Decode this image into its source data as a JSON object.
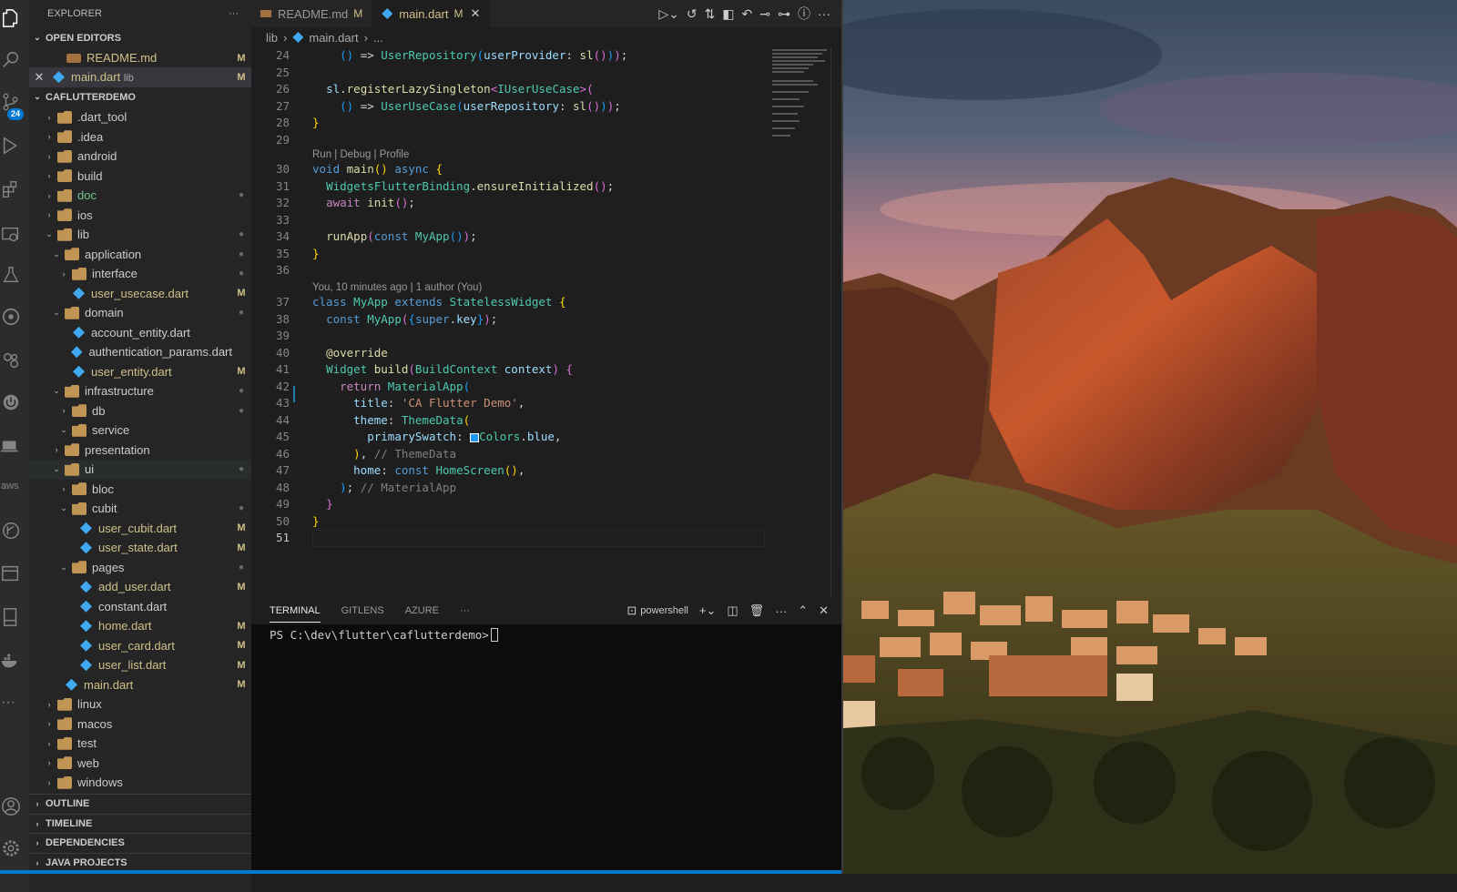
{
  "sidebar": {
    "title": "EXPLORER",
    "more": "···",
    "open_editors_header": "OPEN EDITORS",
    "open_editors": [
      {
        "name": "README.md",
        "status": "M"
      },
      {
        "name": "main.dart",
        "sub": "lib",
        "status": "M"
      }
    ],
    "project_header": "CAFLUTTERDEMO",
    "tree": [
      {
        "label": ".dart_tool"
      },
      {
        "label": ".idea"
      },
      {
        "label": "android"
      },
      {
        "label": "build"
      },
      {
        "label": "doc"
      },
      {
        "label": "ios"
      },
      {
        "label": "lib"
      },
      {
        "label": "application"
      },
      {
        "label": "interface"
      },
      {
        "label": "user_usecase.dart",
        "status": "M"
      },
      {
        "label": "domain"
      },
      {
        "label": "account_entity.dart"
      },
      {
        "label": "authentication_params.dart"
      },
      {
        "label": "user_entity.dart",
        "status": "M"
      },
      {
        "label": "infrastructure"
      },
      {
        "label": "db"
      },
      {
        "label": "service"
      },
      {
        "label": "presentation"
      },
      {
        "label": "ui"
      },
      {
        "label": "bloc"
      },
      {
        "label": "cubit"
      },
      {
        "label": "user_cubit.dart",
        "status": "M"
      },
      {
        "label": "user_state.dart",
        "status": "M"
      },
      {
        "label": "pages"
      },
      {
        "label": "add_user.dart",
        "status": "M"
      },
      {
        "label": "constant.dart"
      },
      {
        "label": "home.dart",
        "status": "M"
      },
      {
        "label": "user_card.dart",
        "status": "M"
      },
      {
        "label": "user_list.dart",
        "status": "M"
      },
      {
        "label": "main.dart",
        "status": "M"
      },
      {
        "label": "linux"
      },
      {
        "label": "macos"
      },
      {
        "label": "test"
      },
      {
        "label": "web"
      },
      {
        "label": "windows"
      }
    ],
    "sections": [
      "OUTLINE",
      "TIMELINE",
      "DEPENDENCIES",
      "JAVA PROJECTS"
    ]
  },
  "activity": {
    "badge": "24",
    "aws_label": "aws"
  },
  "tabs": [
    {
      "label": "README.md",
      "status": "M"
    },
    {
      "label": "main.dart",
      "status": "M",
      "close": "✕"
    }
  ],
  "breadcrumb": {
    "folder": "lib",
    "file": "main.dart",
    "more": "..."
  },
  "editor": {
    "lens_main": "Run | Debug | Profile",
    "lens_blame": "You, 10 minutes ago | 1 author (You)",
    "line_numbers": [
      "24",
      "25",
      "26",
      "27",
      "28",
      "29",
      "30",
      "31",
      "32",
      "33",
      "34",
      "35",
      "36",
      "37",
      "38",
      "39",
      "40",
      "41",
      "42",
      "43",
      "44",
      "45",
      "46",
      "47",
      "48",
      "49",
      "50",
      "51"
    ]
  },
  "panel": {
    "tabs": [
      "TERMINAL",
      "GITLENS",
      "AZURE",
      "···"
    ],
    "shell": "powershell",
    "prompt": "PS C:\\dev\\flutter\\caflutterdemo> "
  }
}
